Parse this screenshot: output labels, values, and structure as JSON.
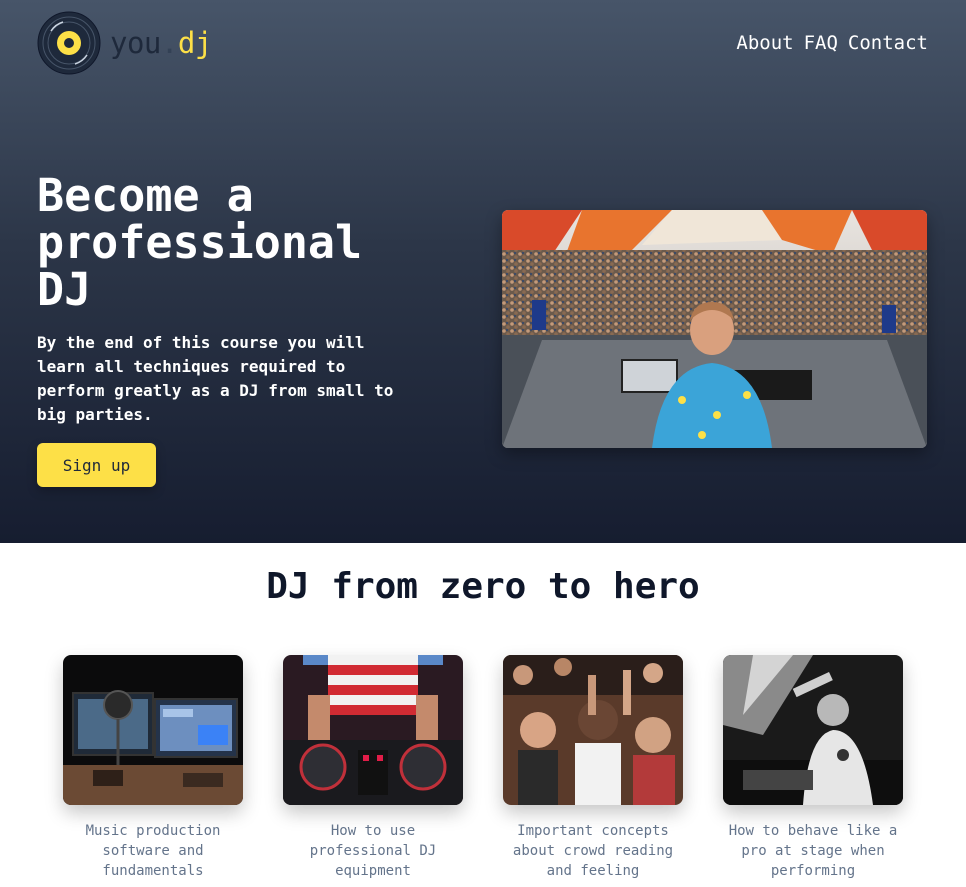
{
  "brand": {
    "name_part1": "you",
    "name_dot": ".",
    "name_part2": "dj"
  },
  "nav": {
    "items": [
      "About",
      "FAQ",
      "Contact"
    ]
  },
  "hero": {
    "title": "Become a professional DJ",
    "description": "By the end of this course you will learn all techniques required to perform greatly as a DJ from small to big parties.",
    "cta_label": "Sign up"
  },
  "section": {
    "title": "DJ from zero to hero",
    "cards": [
      {
        "caption": "Music production software and fundamentals"
      },
      {
        "caption": "How to use professional DJ equipment"
      },
      {
        "caption": "Important concepts about crowd reading and feeling"
      },
      {
        "caption": "How to behave like a pro at stage when performing"
      }
    ]
  },
  "colors": {
    "accent": "#fde047",
    "hero_top": "#475569",
    "hero_bottom": "#161d30",
    "title_dark": "#0f172a",
    "caption": "#64748b"
  }
}
